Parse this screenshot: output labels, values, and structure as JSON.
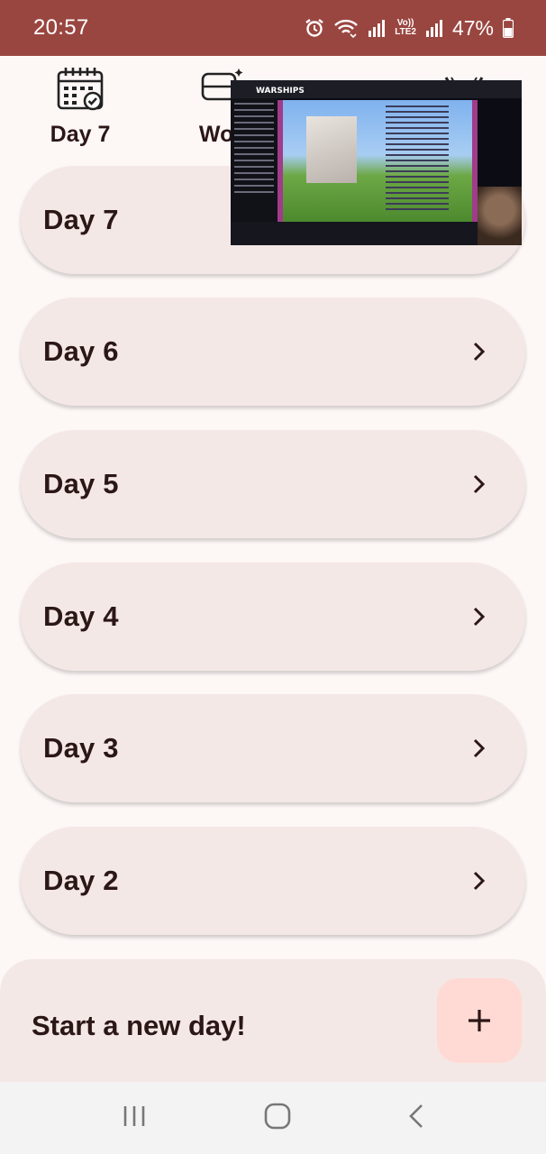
{
  "status_bar": {
    "time": "20:57",
    "network_label_top": "Vo))",
    "network_label_bottom": "LTE2",
    "battery": "47%"
  },
  "tabs": [
    {
      "label": "Day 7",
      "icon": "calendar-check-icon"
    },
    {
      "label": "Wor",
      "icon": "bus-icon"
    },
    {
      "label": "",
      "icon": "v-logo-icon"
    }
  ],
  "days": [
    {
      "label": "Day 7"
    },
    {
      "label": "Day 6"
    },
    {
      "label": "Day 5"
    },
    {
      "label": "Day 4"
    },
    {
      "label": "Day 3"
    },
    {
      "label": "Day 2"
    }
  ],
  "bottom_sheet": {
    "text": "Start a new day!",
    "fab_label": "+"
  },
  "pip": {
    "brand": "WARSHIPS"
  },
  "colors": {
    "status_bar": "#9a4640",
    "background": "#fdf7f6",
    "card": "#f4e8e6",
    "fab": "#ffdad4",
    "text": "#2b1716"
  }
}
